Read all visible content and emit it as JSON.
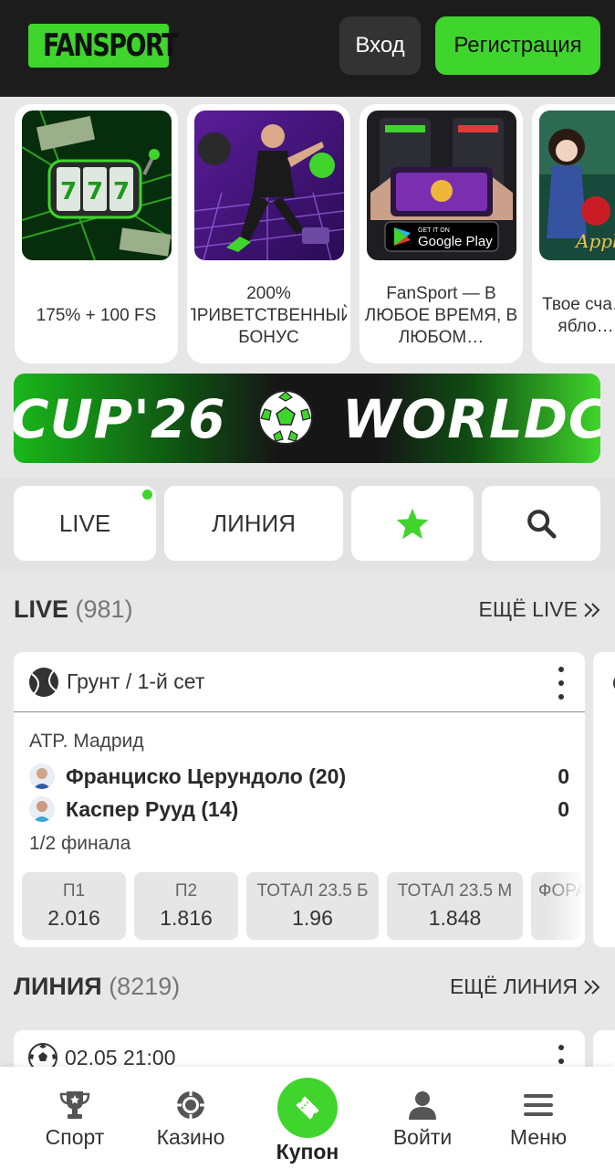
{
  "header": {
    "logo_text": "FANSPORT",
    "login_label": "Вход",
    "register_label": "Регистрация"
  },
  "promos": [
    {
      "text": "175% + 100 FS",
      "image": "slot-777-icon"
    },
    {
      "text": "200% ПРИВЕТСТВЕННЫЙ БОНУС",
      "image": "football-player-icon"
    },
    {
      "text": "FanSport — В ЛЮБОЕ ВРЕМЯ, В ЛЮБОМ…",
      "image": "phone-google-play-icon"
    },
    {
      "text": "Твое сча… ябло…",
      "image": "apple-of-fortune-icon"
    }
  ],
  "promo_badge": {
    "get_it_on": "GET IT ON",
    "store": "Google Play"
  },
  "banner": {
    "text_left": "CUP'26",
    "text_right": "WORLDC"
  },
  "tabs": {
    "live": "LIVE",
    "line": "ЛИНИЯ",
    "favorites_icon": "star-icon",
    "search_icon": "search-icon"
  },
  "live_section": {
    "title": "LIVE",
    "count": "(981)",
    "more": "ЕЩЁ LIVE"
  },
  "match": {
    "header": "Грунт / 1-й сет",
    "league": "ATP. Мадрид",
    "team1": {
      "name": "Франциско Церундоло (20)",
      "score": "0"
    },
    "team2": {
      "name": "Каспер Рууд (14)",
      "score": "0"
    },
    "stage": "1/2 финала",
    "odds": [
      {
        "label": "П1",
        "value": "2.016"
      },
      {
        "label": "П2",
        "value": "1.816"
      },
      {
        "label": "ТОТАЛ 23.5 Б",
        "value": "1.96"
      },
      {
        "label": "ТОТАЛ 23.5 М",
        "value": "1.848"
      },
      {
        "label": "ФОРА",
        "value": ""
      }
    ]
  },
  "line_section": {
    "title": "ЛИНИЯ",
    "count": "(8219)",
    "more": "ЕЩЁ ЛИНИЯ",
    "first_date": "02.05 21:00"
  },
  "bottom_nav": [
    {
      "label": "Спорт",
      "icon": "trophy-icon"
    },
    {
      "label": "Казино",
      "icon": "casino-chip-icon"
    },
    {
      "label": "Купон",
      "icon": "coupon-ticket-icon"
    },
    {
      "label": "Войти",
      "icon": "user-icon"
    },
    {
      "label": "Меню",
      "icon": "menu-icon"
    }
  ],
  "colors": {
    "accent": "#3fd52c",
    "header_bg": "#1c1c1c",
    "page_bg": "#e7e7e7"
  }
}
